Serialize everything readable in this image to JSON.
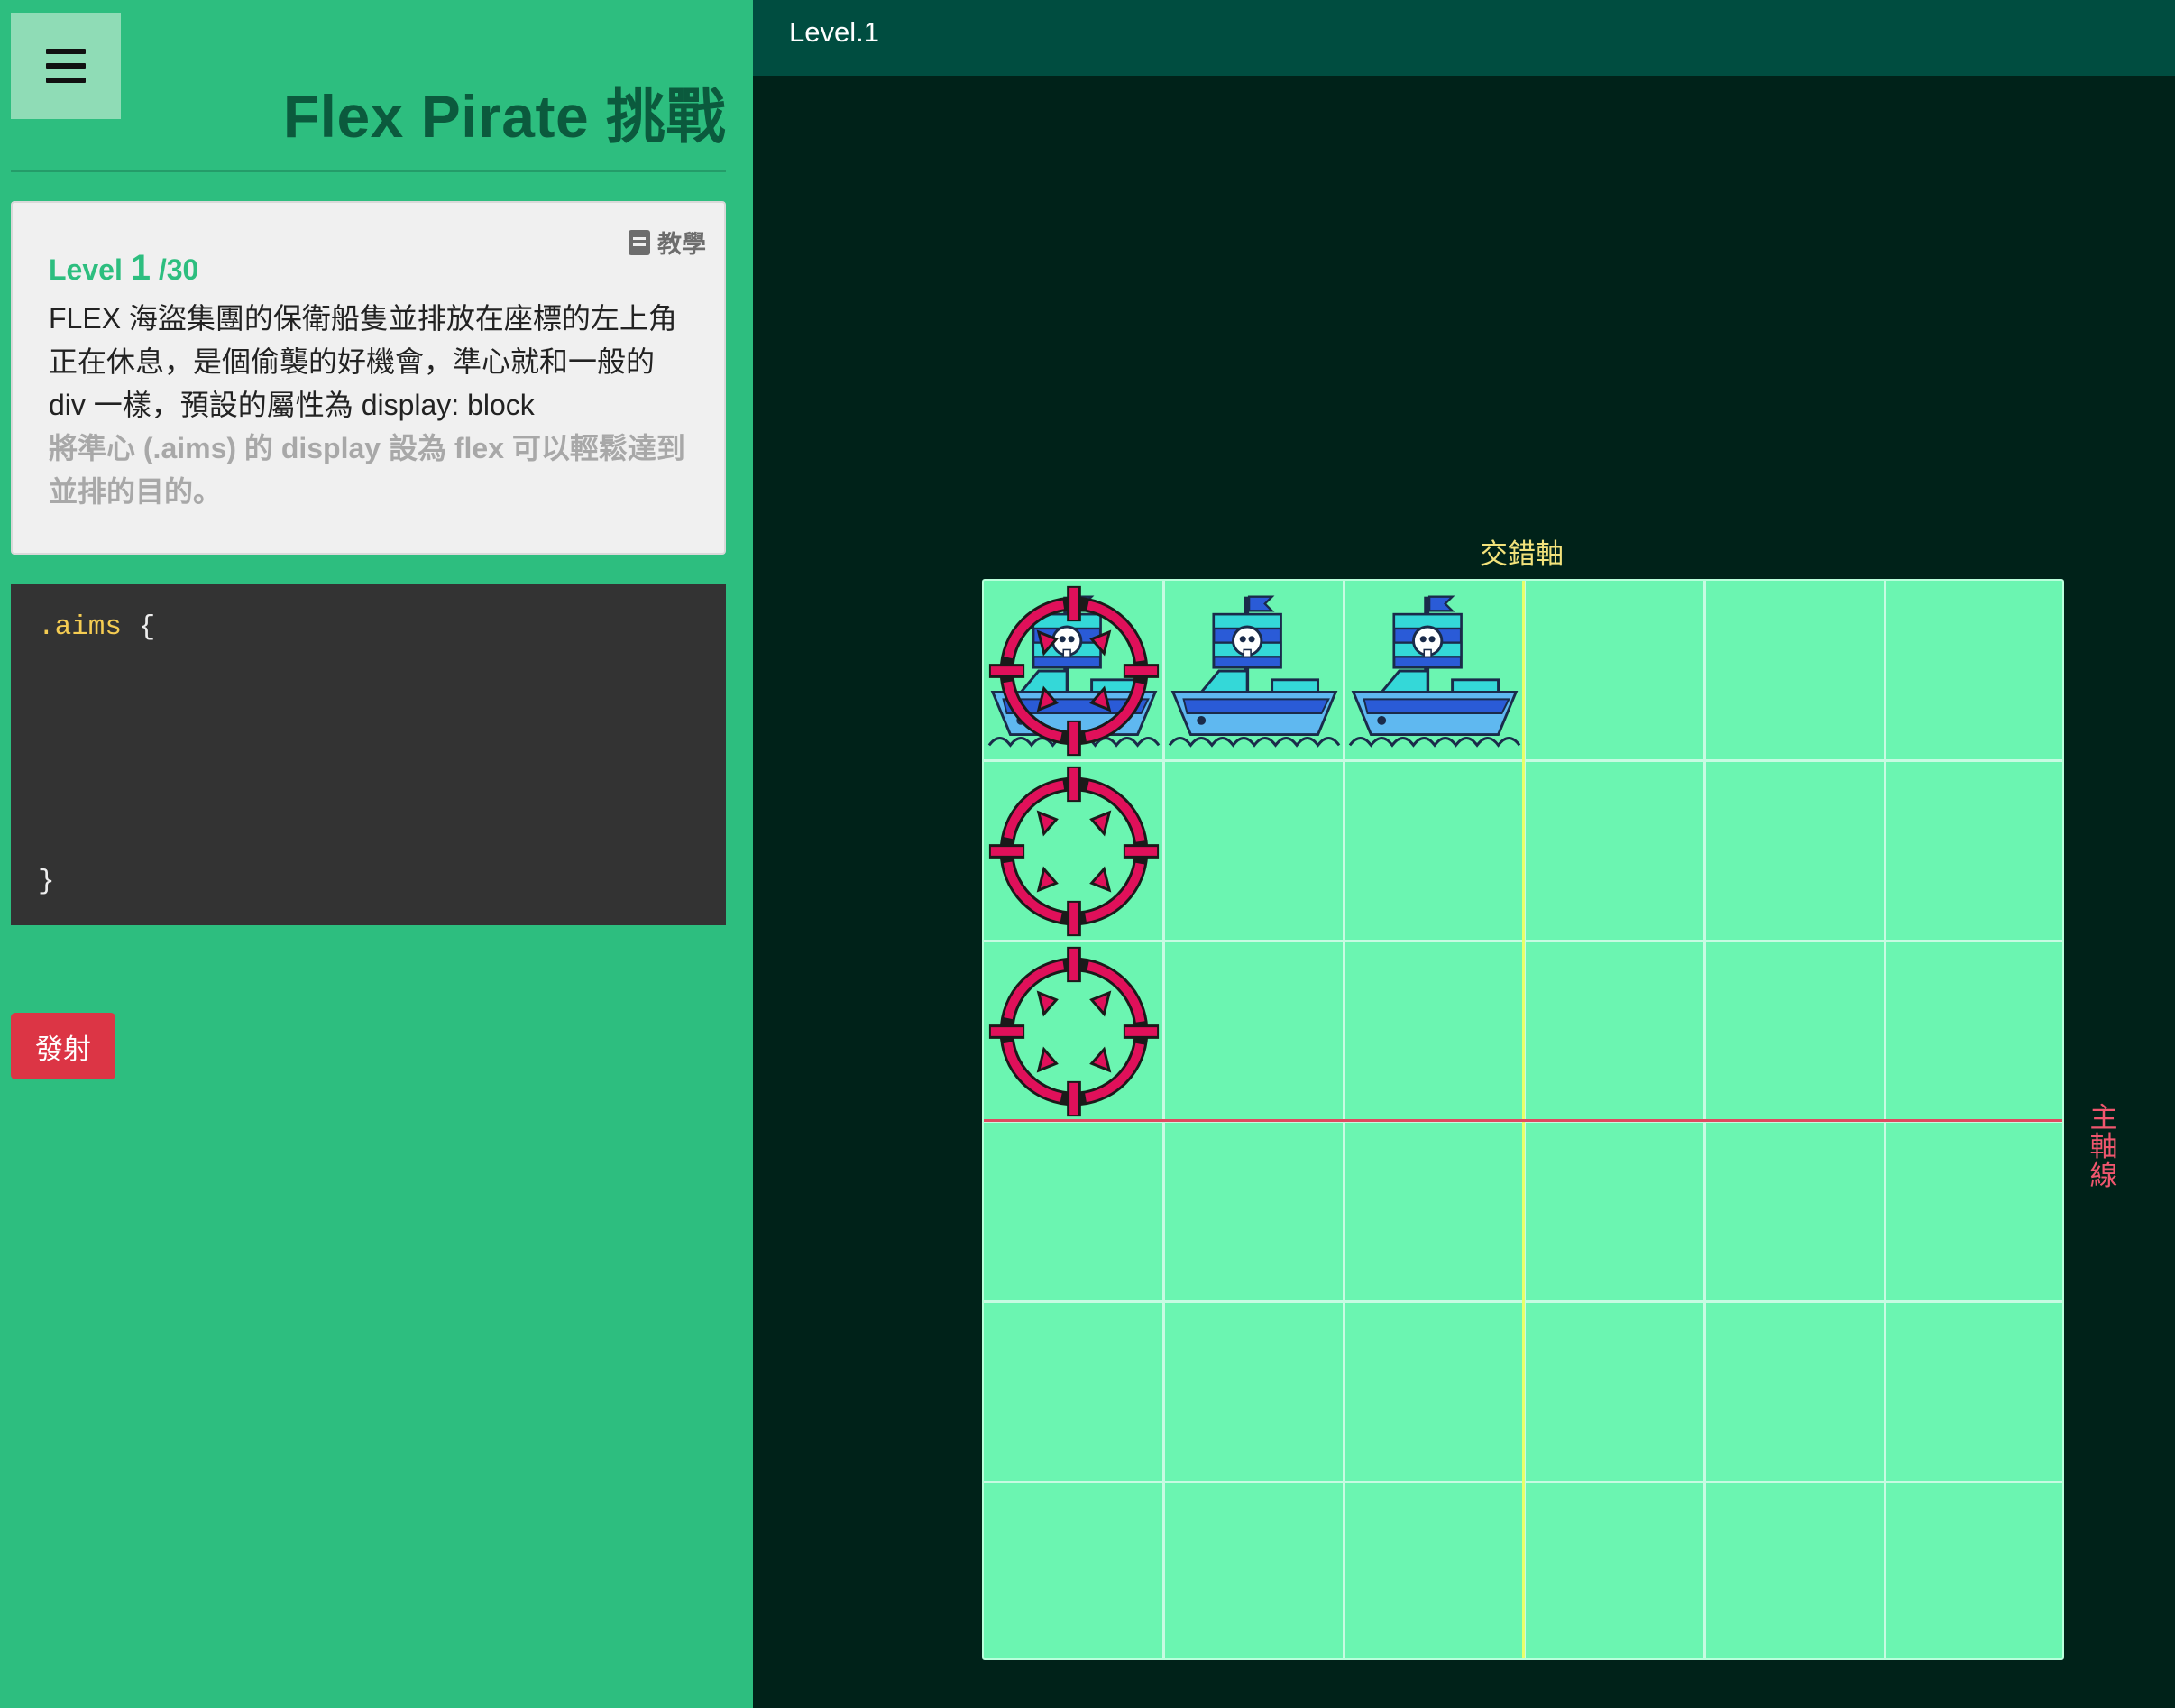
{
  "sidebar": {
    "title": "Flex Pirate 挑戰",
    "tutorial_label": "教學",
    "level": {
      "prefix": "Level",
      "current": "1",
      "total": "/30",
      "description": "FLEX 海盜集團的保衛船隻並排放在座標的左上角正在休息，是個偷襲的好機會，準心就和一般的 div 一樣，預設的屬性為 display: block",
      "hint": "將準心 (.aims) 的 display 設為 flex 可以輕鬆達到並排的目的。"
    },
    "editor": {
      "selector": ".aims",
      "open_brace": "{",
      "close_brace": "}",
      "value": ""
    },
    "fire_label": "發射"
  },
  "topbar": {
    "level_label": "Level.1"
  },
  "board": {
    "cross_axis_label": "交錯軸",
    "main_axis_label": "主軸線",
    "grid": {
      "cols": 6,
      "rows": 6
    },
    "ships": [
      {
        "col": 0,
        "row": 0
      },
      {
        "col": 1,
        "row": 0
      },
      {
        "col": 2,
        "row": 0
      }
    ],
    "aims": [
      {
        "col": 0,
        "row": 0
      },
      {
        "col": 0,
        "row": 1
      },
      {
        "col": 0,
        "row": 2
      }
    ]
  },
  "colors": {
    "sidebar_bg": "#2dbe7f",
    "title_color": "#0b5a3d",
    "fire_button": "#dc3545",
    "board_bg": "#6bf5b1",
    "cross_axis": "#e7ff6a",
    "main_axis": "#e04a61",
    "aim": "#e0105a",
    "ship_hull": "#5fb8f0"
  },
  "icons": [
    "menu-icon",
    "book-icon",
    "pirate-ship-icon",
    "crosshair-icon"
  ]
}
